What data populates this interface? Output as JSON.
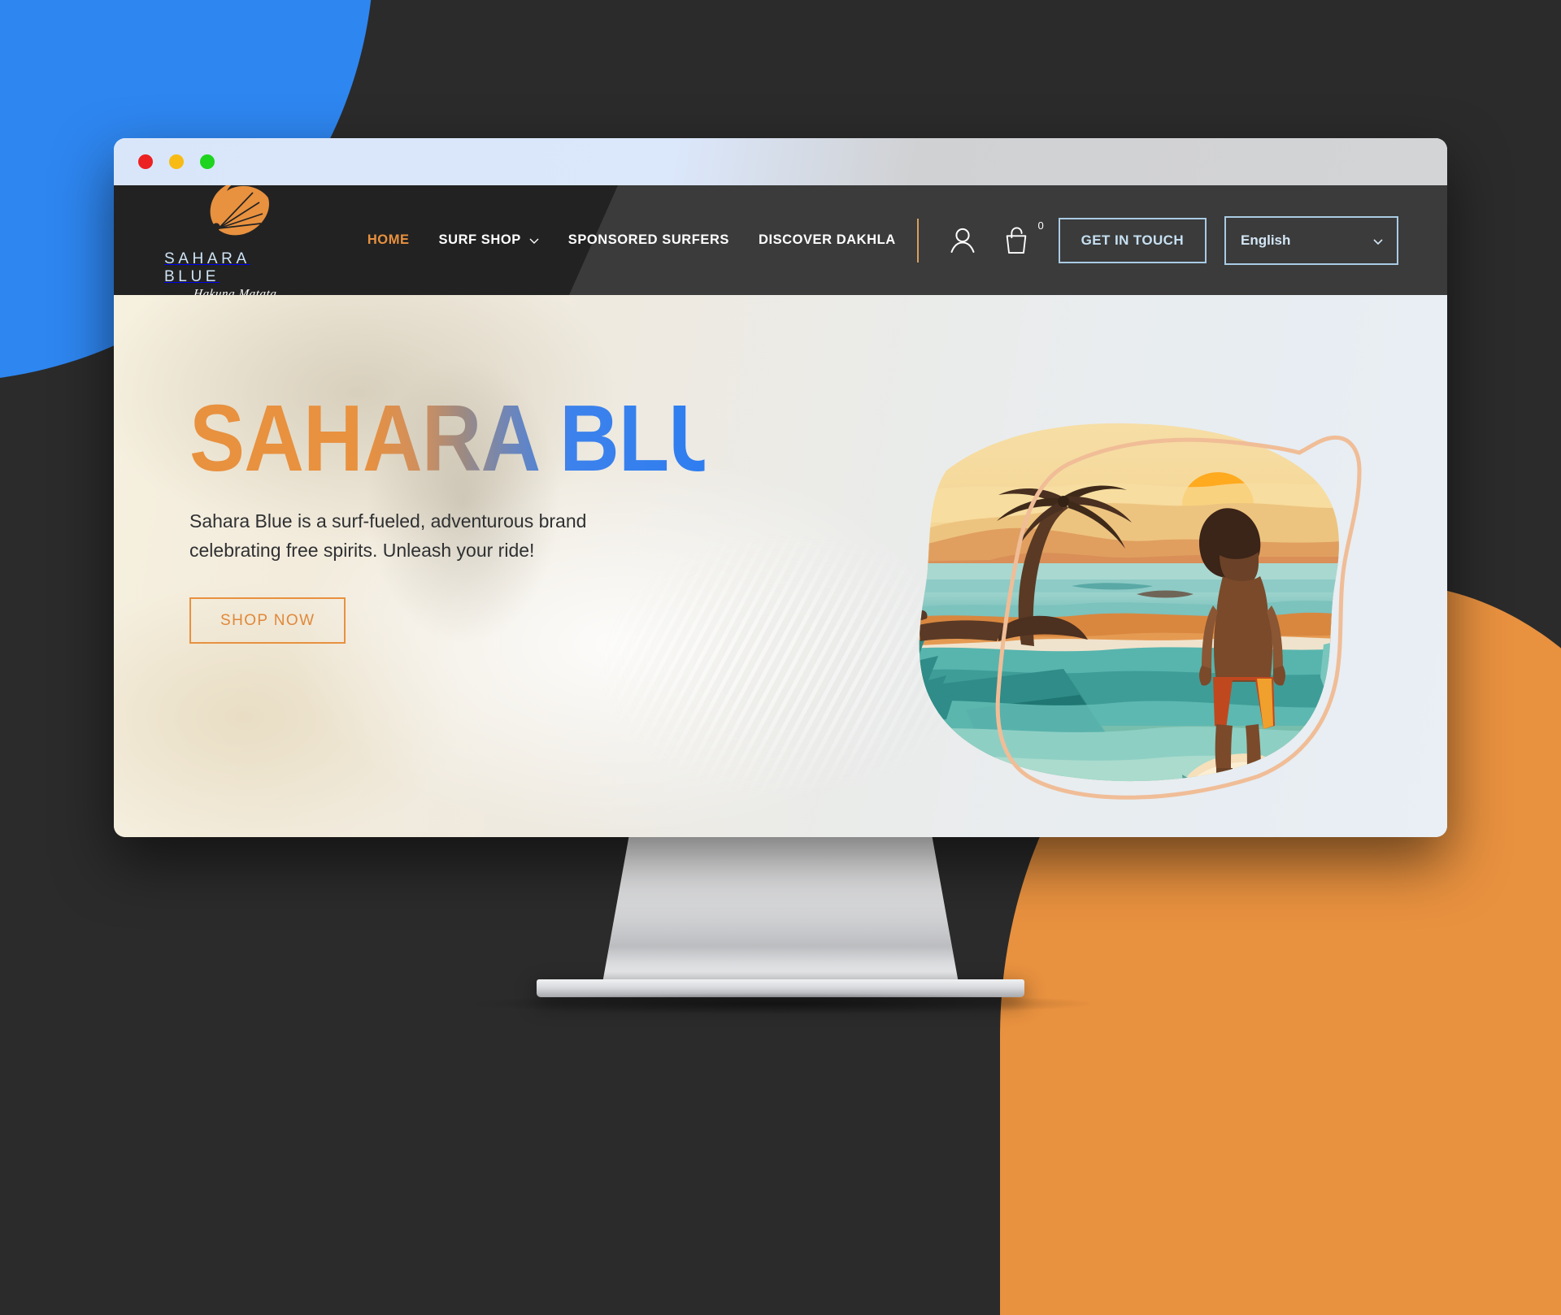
{
  "window": {
    "traffic_lights": [
      "close",
      "minimize",
      "maximize"
    ]
  },
  "brand": {
    "name": "SAHARA BLUE",
    "tagline": "Hakuna Matata",
    "logo_icon": "kite-surfer-icon"
  },
  "nav": {
    "items": [
      {
        "label": "HOME",
        "active": true,
        "has_dropdown": false
      },
      {
        "label": "SURF SHOP",
        "active": false,
        "has_dropdown": true
      },
      {
        "label": "SPONSORED SURFERS",
        "active": false,
        "has_dropdown": false
      },
      {
        "label": "DISCOVER DAKHLA",
        "active": false,
        "has_dropdown": false
      }
    ]
  },
  "header_actions": {
    "account_icon": "user-icon",
    "cart_icon": "shopping-bag-icon",
    "cart_count": "0",
    "contact_label": "GET IN TOUCH",
    "language_value": "English",
    "language_options": [
      "English"
    ],
    "language_chevron": "chevron-down-icon"
  },
  "hero": {
    "title_part_one": "SAHARA",
    "title_part_two": "BLUE",
    "title_full": "SAHARA BLUE",
    "subtitle": "Sahara Blue is a surf-fueled, adventurous brand celebrating free spirits. Unleash your ride!",
    "cta_label": "SHOP NOW",
    "illustration": "surfer-sunset-illustration"
  },
  "colors": {
    "accent_orange": "#e8913f",
    "accent_blue": "#2e86f0",
    "header_dark": "#222222",
    "page_dark": "#2b2b2b",
    "light_blue_text": "#c6e0f2",
    "hero_sand": "#f6f0df"
  }
}
